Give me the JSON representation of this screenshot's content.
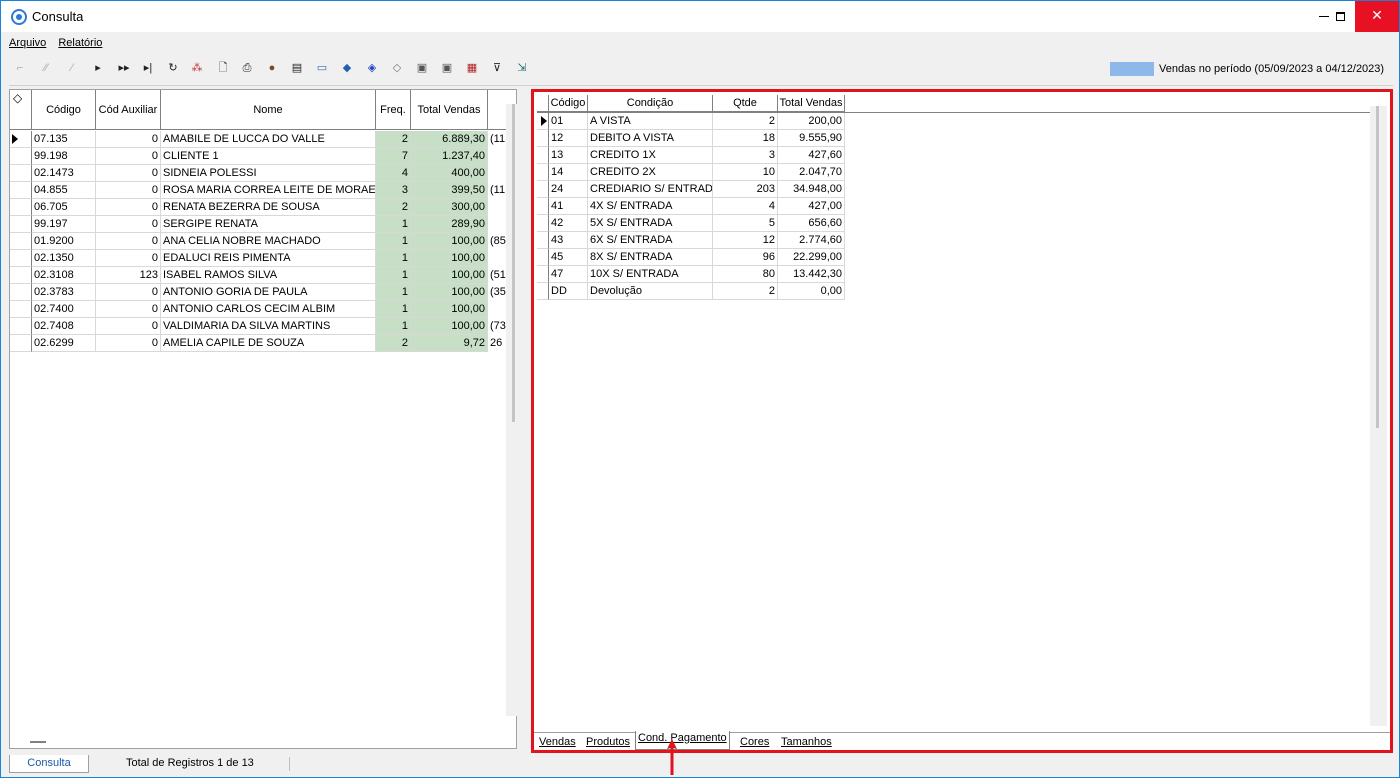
{
  "window": {
    "title": "Consulta"
  },
  "menu": {
    "arquivo": "Arquivo",
    "relatorio": "Relatório"
  },
  "toolbar": {
    "icons": [
      "first-record-icon",
      "prior-page-icon",
      "prior-record-icon",
      "next-icon",
      "next-page-icon",
      "last-icon",
      "refresh-icon",
      "wand-icon",
      "preview-icon",
      "print-icon",
      "user-icon",
      "document-icon",
      "card-icon",
      "tag-icon",
      "label-icon",
      "gold-icon",
      "silver-icon",
      "photo-icon",
      "export-icon",
      "filter-icon",
      "exit-icon"
    ]
  },
  "legend": {
    "text": "Vendas no período (05/09/2023 a 04/12/2023)",
    "color": "#8db8e9"
  },
  "left_grid": {
    "headers": {
      "codigo": "Código",
      "cod_auxiliar": "Cód Auxiliar",
      "nome": "Nome",
      "freq": "Freq.",
      "total_vendas": "Total Vendas"
    },
    "rows": [
      {
        "codigo": "07.135",
        "aux": "0",
        "nome": "AMABILE DE LUCCA DO VALLE",
        "freq": "2",
        "total": "6.889,30",
        "extra": "(11"
      },
      {
        "codigo": "99.198",
        "aux": "0",
        "nome": "CLIENTE 1",
        "freq": "7",
        "total": "1.237,40",
        "extra": ""
      },
      {
        "codigo": "02.1473",
        "aux": "0",
        "nome": "SIDNEIA POLESSI",
        "freq": "4",
        "total": "400,00",
        "extra": ""
      },
      {
        "codigo": "04.855",
        "aux": "0",
        "nome": "ROSA MARIA CORREA LEITE DE MORAES",
        "freq": "3",
        "total": "399,50",
        "extra": "(11"
      },
      {
        "codigo": "06.705",
        "aux": "0",
        "nome": "RENATA  BEZERRA DE SOUSA",
        "freq": "2",
        "total": "300,00",
        "extra": ""
      },
      {
        "codigo": "99.197",
        "aux": "0",
        "nome": "SERGIPE RENATA",
        "freq": "1",
        "total": "289,90",
        "extra": ""
      },
      {
        "codigo": "01.9200",
        "aux": "0",
        "nome": "ANA CELIA NOBRE MACHADO",
        "freq": "1",
        "total": "100,00",
        "extra": "(85"
      },
      {
        "codigo": "02.1350",
        "aux": "0",
        "nome": "EDALUCI REIS PIMENTA",
        "freq": "1",
        "total": "100,00",
        "extra": ""
      },
      {
        "codigo": "02.3108",
        "aux": "123",
        "nome": "ISABEL RAMOS SILVA",
        "freq": "1",
        "total": "100,00",
        "extra": "(51"
      },
      {
        "codigo": "02.3783",
        "aux": "0",
        "nome": "ANTONIO GORIA DE PAULA",
        "freq": "1",
        "total": "100,00",
        "extra": "(35"
      },
      {
        "codigo": "02.7400",
        "aux": "0",
        "nome": "ANTONIO CARLOS CECIM ALBIM",
        "freq": "1",
        "total": "100,00",
        "extra": ""
      },
      {
        "codigo": "02.7408",
        "aux": "0",
        "nome": "VALDIMARIA DA SILVA MARTINS",
        "freq": "1",
        "total": "100,00",
        "extra": "(73"
      },
      {
        "codigo": "02.6299",
        "aux": "0",
        "nome": "AMELIA CAPILE DE SOUZA",
        "freq": "2",
        "total": "9,72",
        "extra": "26"
      }
    ]
  },
  "right_grid": {
    "headers": {
      "codigo": "Código",
      "condicao": "Condição",
      "qtde": "Qtde",
      "total_vendas": "Total Vendas"
    },
    "rows": [
      {
        "codigo": "01",
        "condicao": "A VISTA",
        "qtde": "2",
        "total": "200,00"
      },
      {
        "codigo": "12",
        "condicao": "DEBITO A VISTA",
        "qtde": "18",
        "total": "9.555,90"
      },
      {
        "codigo": "13",
        "condicao": "CREDITO 1X",
        "qtde": "3",
        "total": "427,60"
      },
      {
        "codigo": "14",
        "condicao": "CREDITO 2X",
        "qtde": "10",
        "total": "2.047,70"
      },
      {
        "codigo": "24",
        "condicao": "CREDIARIO S/ ENTRADA",
        "qtde": "203",
        "total": "34.948,00"
      },
      {
        "codigo": "41",
        "condicao": "4X S/ ENTRADA",
        "qtde": "4",
        "total": "427,00"
      },
      {
        "codigo": "42",
        "condicao": "5X S/ ENTRADA",
        "qtde": "5",
        "total": "656,60"
      },
      {
        "codigo": "43",
        "condicao": "6X S/ ENTRADA",
        "qtde": "12",
        "total": "2.774,60"
      },
      {
        "codigo": "45",
        "condicao": "8X S/ ENTRADA",
        "qtde": "96",
        "total": "22.299,00"
      },
      {
        "codigo": "47",
        "condicao": "10X S/ ENTRADA",
        "qtde": "80",
        "total": "13.442,30"
      },
      {
        "codigo": "DD",
        "condicao": "Devolução",
        "qtde": "2",
        "total": "0,00"
      }
    ]
  },
  "tabs": [
    "Vendas",
    "Produtos",
    "Cond. Pagamento",
    "Cores",
    "Tamanhos"
  ],
  "active_tab": "Cond. Pagamento",
  "status": {
    "tab": "Consulta",
    "text": "Total de Registros 1 de 13"
  }
}
